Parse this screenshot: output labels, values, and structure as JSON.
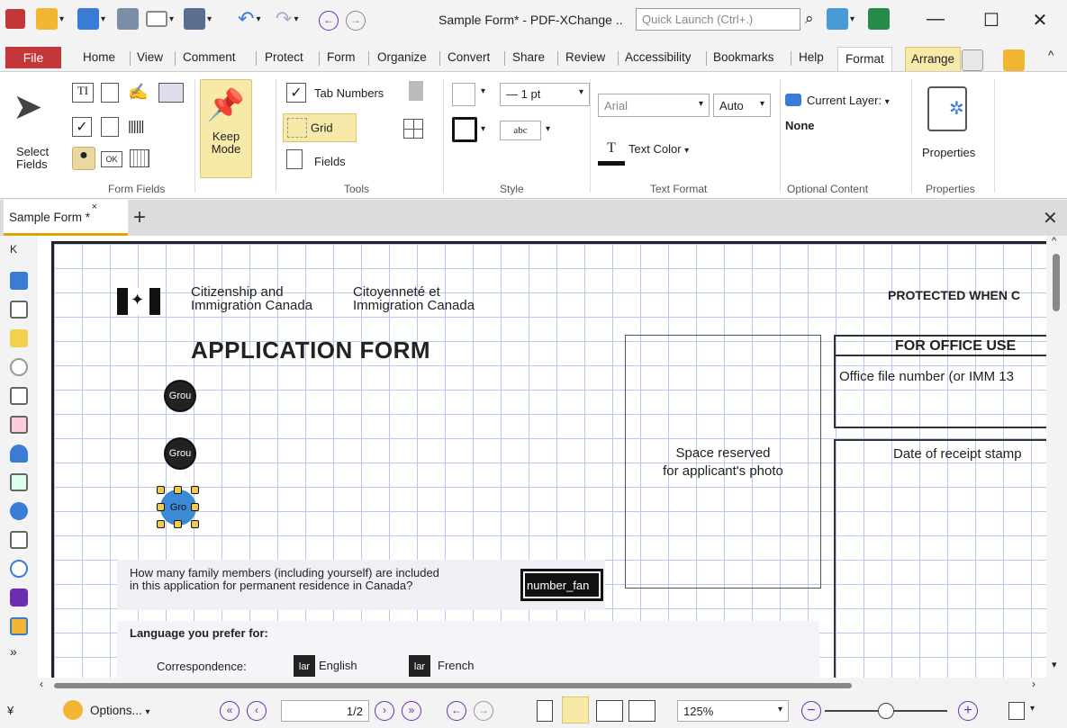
{
  "window": {
    "title": "Sample Form* - PDF-XChange ..",
    "quick_launch_placeholder": "Quick Launch (Ctrl+.)"
  },
  "menu": {
    "file": "File",
    "tabs": [
      "Home",
      "View",
      "Comment",
      "Protect",
      "Form",
      "Organize",
      "Convert",
      "Share",
      "Review",
      "Accessibility",
      "Bookmarks",
      "Help"
    ],
    "active_tab": "Format",
    "context_tab": "Arrange"
  },
  "ribbon": {
    "select_fields": "Select Fields",
    "keep_mode": "Keep Mode",
    "tab_numbers": "Tab Numbers",
    "grid": "Grid",
    "fields": "Fields",
    "line_width": "1 pt",
    "abc": "abc",
    "font": "Arial",
    "font_size": "Auto",
    "text_color": "Text Color",
    "current_layer": "Current Layer:",
    "layer_value": "None",
    "properties": "Properties",
    "groups": {
      "form_fields": "Form Fields",
      "tools": "Tools",
      "style": "Style",
      "text_format": "Text Format",
      "optional_content": "Optional Content",
      "properties": "Properties"
    }
  },
  "doc_tab": {
    "name": "Sample Form *"
  },
  "page": {
    "org_en_1": "Citizenship and",
    "org_en_2": "Immigration Canada",
    "org_fr_1": "Citoyenneté et",
    "org_fr_2": "Immigration Canada",
    "protected": "PROTECTED WHEN C",
    "title": "APPLICATION FORM",
    "photo_1": "Space reserved",
    "photo_2": "for applicant's photo",
    "office_use": "FOR OFFICE USE",
    "office_file": "Office file number (or IMM 13",
    "receipt": "Date of receipt stamp",
    "family_q1": "How many family members (including yourself) are included",
    "family_q2": "in this application for permanent residence in Canada?",
    "number_field": "number_fan",
    "lang_heading": "Language you prefer for:",
    "correspondence": "Correspondence:",
    "english": "English",
    "french": "French",
    "lan_field": "lar",
    "group_field": "Grou",
    "group_field_selected": "Gro"
  },
  "status": {
    "options": "Options...",
    "page_box": "1/2",
    "zoom": "125%"
  },
  "colors": {
    "file_red": "#c2373a",
    "arrange_yellow": "#f7e9a8",
    "grid_blue": "#b8c8f0",
    "nav_purple": "#6a2fb0"
  }
}
